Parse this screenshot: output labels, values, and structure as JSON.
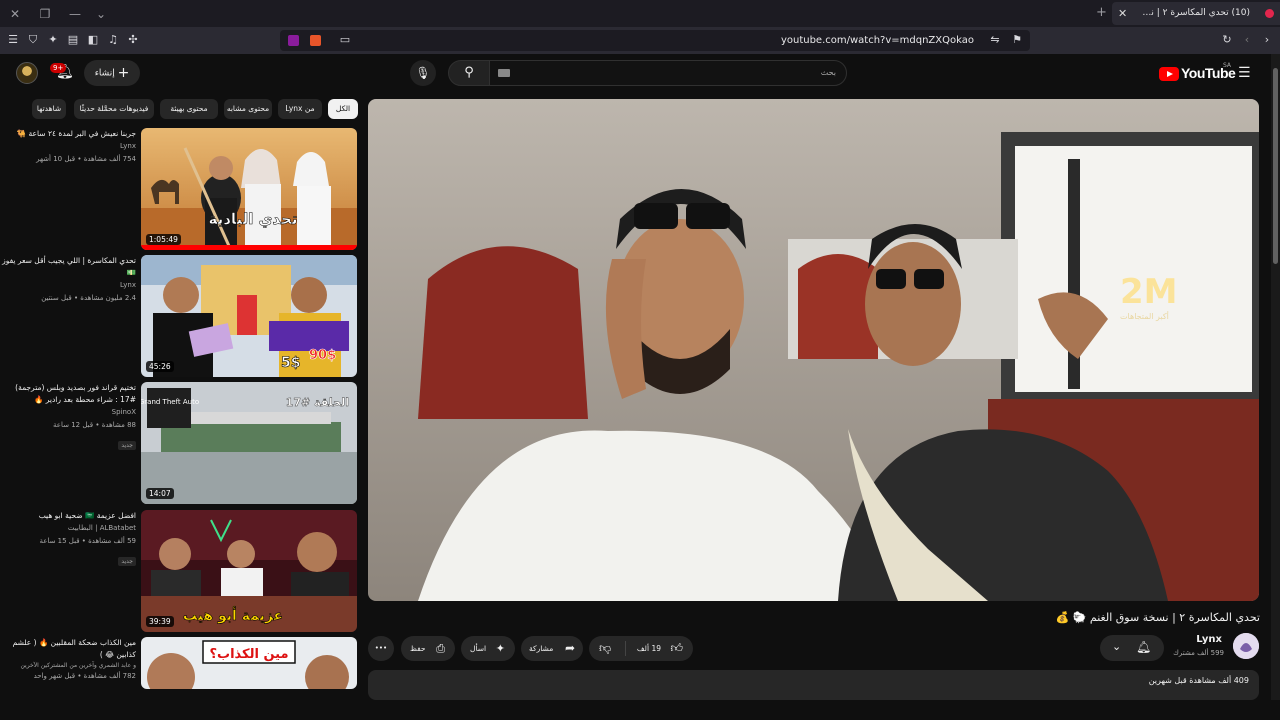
{
  "browser": {
    "tab_title": "(10) تحدي المكاسرة ٢ | نسخة سـ",
    "url": "youtube.com/watch?v=mdqnZXQokao",
    "tab_close": "✕",
    "new_tab": "+",
    "win_close": "✕",
    "win_restore": "❐",
    "win_min": "—",
    "win_menu": "⌄"
  },
  "header": {
    "create_label": "إنشاء",
    "notification_count": "9+",
    "search_placeholder": "بحث",
    "logo_text": "YouTube",
    "country_code": "SA"
  },
  "chips": [
    "الكل",
    "من Lynx",
    "محتوى مشابه",
    "محتوى بهيئة",
    "فيديوهات محمَّلة حديثًا",
    "شاهدتها"
  ],
  "related": [
    {
      "title": "جربنا نعيش في البر لمدة ٢٤ ساعة 🐫",
      "channel": "Lynx",
      "meta": "754 ألف مشاهدة • قبل 10 أشهر",
      "duration": "1:05:49"
    },
    {
      "title": "تحدي المكاسرة | اللي يجيب أقل سعر يفوز 💵",
      "channel": "Lynx",
      "meta": "2.4 مليون مشاهدة • قبل سنتين",
      "duration": "45:26"
    },
    {
      "title": "تختيم قراند فور بصديد وبلس (مترجمة) #17 : شراء محطة بعد رادير 🔥",
      "channel": "SpinoX",
      "meta": "88 مشاهدة • قبل 12 ساعة",
      "badge": "جديد",
      "duration": "14:07"
    },
    {
      "title": "افضل عزيمة 🇸🇦 ضحية ابو هيب",
      "channel": "ALBatabet | البطابيت",
      "meta": "59 ألف مشاهدة • قبل 15 ساعة",
      "badge": "جديد",
      "duration": "39:39"
    },
    {
      "title": "مين الكذاب ضحكة المقلبين 🔥 ( علشم كذابين 😂 )",
      "channel": "و عابد الشمري وآخرين من المشتركين الآخرين",
      "meta": "782 ألف مشاهدة • قبل شهر واحد",
      "duration": ""
    }
  ],
  "thumb_text": {
    "t1": "تحدي البادية",
    "t2_a": "5$",
    "t2_b": "90$",
    "t3_a": "Grand Theft Auto",
    "t3_b": "الحلقة #17",
    "t4": "عزيمة أبو هيب",
    "t5": "مين الكذاب؟"
  },
  "player": {
    "overlay_number": "2M",
    "overlay_sub": "أكبر المتجاهات"
  },
  "video": {
    "title": "تحدي المكاسرة ٢ | نسخة سوق الغنم 🐑 💰",
    "channel_name": "Lynx",
    "subscribers": "599 ألف مشترك",
    "likes": "19 ألف",
    "share": "مشاركة",
    "ask": "اسأل",
    "save": "حفظ",
    "more": "•••",
    "views_time": "409 ألف مشاهدة قبل شهرين"
  },
  "colors": {
    "yt_red": "#ff0000",
    "bg": "#0f0f0f",
    "chip": "#272727"
  }
}
